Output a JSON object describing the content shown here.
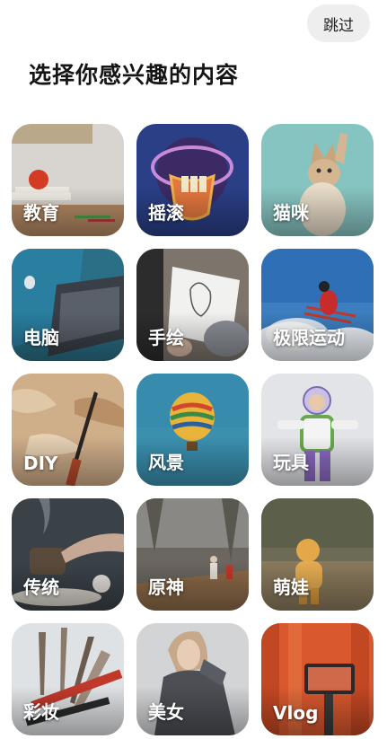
{
  "header": {
    "skip_label": "跳过",
    "title": "选择你感兴趣的内容"
  },
  "interests": [
    {
      "label": "教育",
      "icon": "education-image"
    },
    {
      "label": "摇滚",
      "icon": "rock-image"
    },
    {
      "label": "猫咪",
      "icon": "cat-image"
    },
    {
      "label": "电脑",
      "icon": "computer-image"
    },
    {
      "label": "手绘",
      "icon": "drawing-image"
    },
    {
      "label": "极限运动",
      "icon": "extreme-sports-image"
    },
    {
      "label": "DIY",
      "icon": "diy-image"
    },
    {
      "label": "风景",
      "icon": "landscape-image"
    },
    {
      "label": "玩具",
      "icon": "toy-image"
    },
    {
      "label": "传统",
      "icon": "tradition-image"
    },
    {
      "label": "原神",
      "icon": "genshin-image"
    },
    {
      "label": "萌娃",
      "icon": "cute-kid-image"
    },
    {
      "label": "彩妆",
      "icon": "makeup-image"
    },
    {
      "label": "美女",
      "icon": "beauty-image"
    },
    {
      "label": "Vlog",
      "icon": "vlog-image"
    }
  ]
}
